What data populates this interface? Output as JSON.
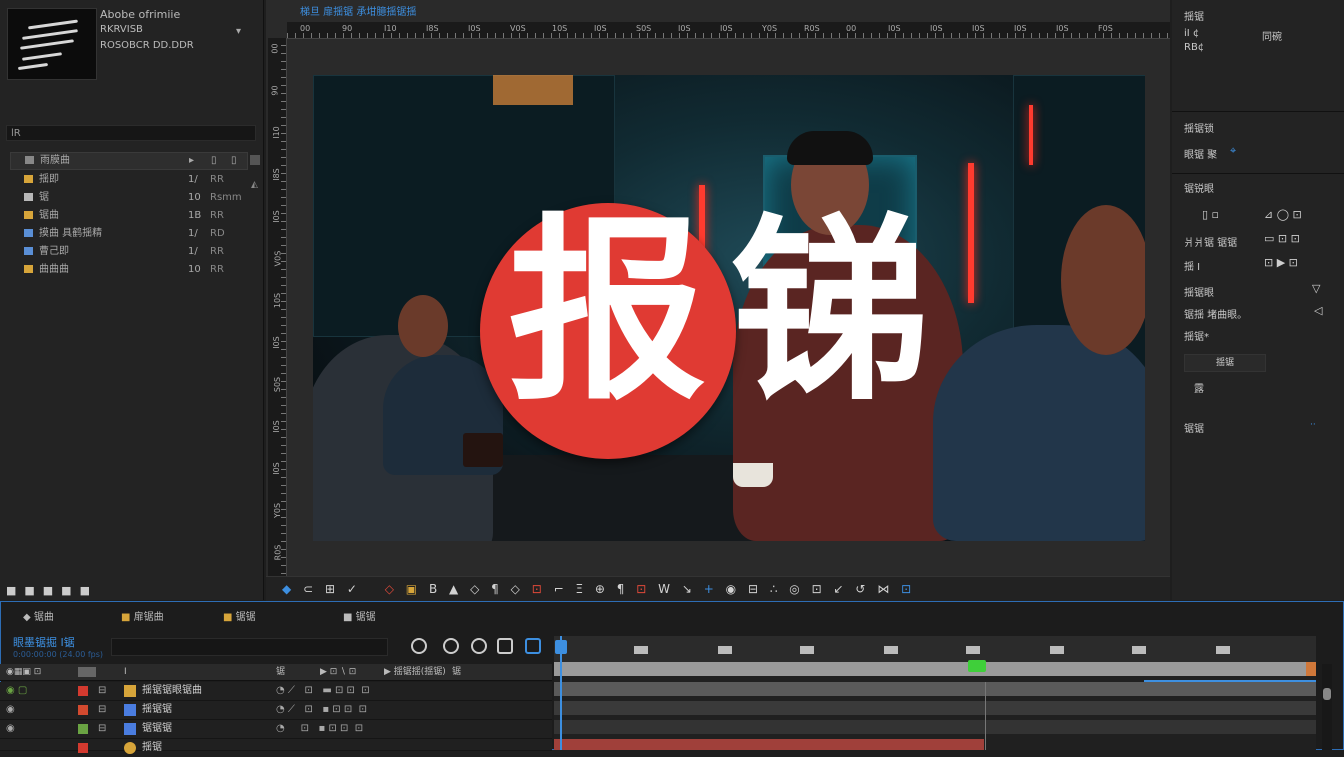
{
  "project": {
    "title": "Abobe ofrimiie",
    "meta_line2": "RKRVISB",
    "meta_line3": "ROSOBCR DD.DDR",
    "search_placeholder": "lR",
    "col_name": "雨膜曲",
    "items": [
      {
        "label": "揺即",
        "num": "1/",
        "val": "RR",
        "color": "#d7a53a"
      },
      {
        "label": "锯",
        "num": "10",
        "val": "Rsmm",
        "color": "#b8b8b8"
      },
      {
        "label": "锯曲",
        "num": "1B",
        "val": "RR",
        "color": "#d7a53a"
      },
      {
        "label": "摸曲 具鹤揺精",
        "num": "1/",
        "val": "RD",
        "color": "#5a8fd6"
      },
      {
        "label": "曹己即",
        "num": "1/",
        "val": "RR",
        "color": "#5a8fd6"
      },
      {
        "label": "曲曲曲",
        "num": "10",
        "val": "RR",
        "color": "#d7a53a"
      }
    ],
    "bottom_icons": "■■■■■"
  },
  "viewer": {
    "title": "梯旦 扉揺锯 承坩臆揺锯揺",
    "error_text_1": "报",
    "error_text_2": "锑",
    "ruler_labels_h": [
      "00",
      "90",
      "I10",
      "I8S",
      "I0S",
      "V0S",
      "10S",
      "I0S",
      "S0S",
      "I0S",
      "I0S",
      "Y0S",
      "R0S",
      "00",
      "I0S",
      "I0S",
      "I0S",
      "I0S",
      "I0S",
      "F0S"
    ],
    "toolbar": [
      "◆",
      "⊂",
      "⊞",
      "✓",
      "◇",
      "▣",
      "B",
      "▲",
      "◇",
      "¶",
      "◇",
      "⊡",
      "⌐",
      "Ξ",
      "⊕",
      "¶",
      "⊡",
      "W",
      "↘",
      "+",
      "◉",
      "⊟",
      "∴",
      "◎",
      "⊡",
      "↙",
      "↺",
      "⋈",
      "⊡",
      "⊕",
      "⊡",
      "⊡"
    ]
  },
  "right": {
    "info_title": "揺锯",
    "info_l1": "iI ¢",
    "info_l2": "同碗",
    "info_l3": "RB¢",
    "section1": "揺锯锁",
    "section1_sub": "眼锯 聚",
    "section2": "锯锐眼",
    "row1": "爿爿锯 锯锯",
    "row2": "揺 I",
    "row3": "揺锯眼",
    "row4": "锯揺 堵曲眼。",
    "row5": "揺锯*",
    "tab": "揺锯",
    "small": "露",
    "footer": "锯锯"
  },
  "timeline": {
    "tabs": [
      "锯曲",
      "扉锯曲",
      "锯锯",
      "锯锯"
    ],
    "timecode": "眼墨锯掘 I锯",
    "subcode": "0:00:00:00 (24.00 fps)",
    "header_cols": [
      "I",
      "锯",
      "▶ 揺锯揺(揺锯)",
      "锯"
    ],
    "layers": [
      {
        "name": "揺锯锯眼锯曲",
        "color": "#d33a2f",
        "ico": "#d7a53a"
      },
      {
        "name": "揺锯锯",
        "color": "#d34a2f",
        "ico": "#4a7de0"
      },
      {
        "name": "锯锯锯",
        "color": "#6aa343",
        "ico": "#4a7de0"
      },
      {
        "name": "揺锯",
        "color": "#d33a2f",
        "ico": "#d7a53a"
      }
    ]
  }
}
